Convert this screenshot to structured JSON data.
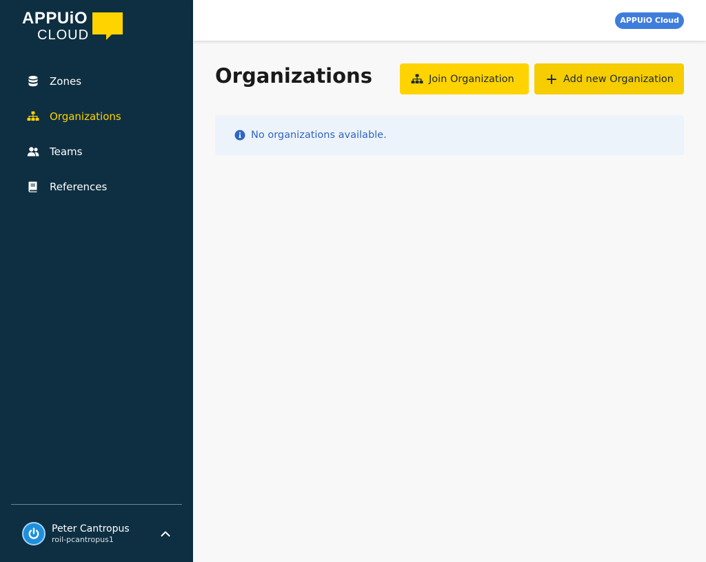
{
  "brand": {
    "logo_top": "APPUiO",
    "logo_bottom": "CLOUD",
    "accent_color": "#ffd300",
    "sidebar_color": "#0e2f42"
  },
  "sidebar": {
    "items": [
      {
        "label": "Zones",
        "icon": "database-icon",
        "active": false
      },
      {
        "label": "Organizations",
        "icon": "sitemap-icon",
        "active": true
      },
      {
        "label": "Teams",
        "icon": "users-icon",
        "active": false
      },
      {
        "label": "References",
        "icon": "book-icon",
        "active": false
      }
    ]
  },
  "user": {
    "name": "Peter Cantropus",
    "login": "roil-pcantropus1",
    "avatar_icon": "power-icon",
    "toggle_icon": "chevron-up-icon"
  },
  "topbar": {
    "env_badge": "APPUiO Cloud"
  },
  "main": {
    "title": "Organizations",
    "join_button": "Join Organization",
    "add_button": "Add new Organization",
    "info_message": "No organizations available."
  }
}
